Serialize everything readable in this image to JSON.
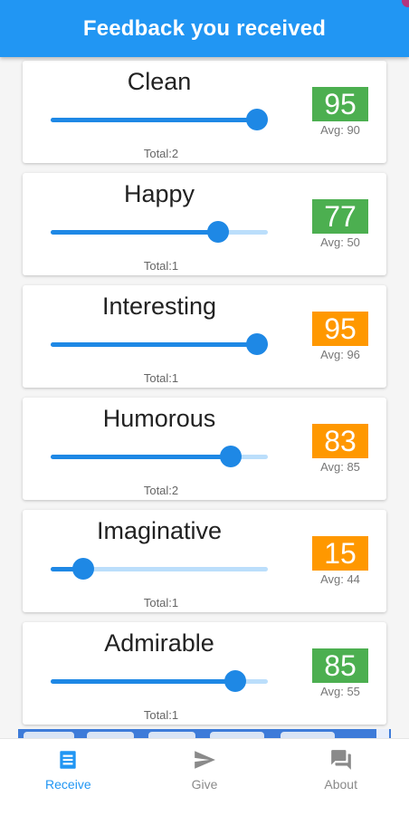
{
  "app": {
    "title": "Feedback you received"
  },
  "cards": [
    {
      "label": "Clean",
      "score": "95",
      "avg": "Avg: 90",
      "total": "Total:2",
      "slider_fraction": 0.95,
      "badge_color": "#4caf50"
    },
    {
      "label": "Happy",
      "score": "77",
      "avg": "Avg: 50",
      "total": "Total:1",
      "slider_fraction": 0.77,
      "badge_color": "#4caf50"
    },
    {
      "label": "Interesting",
      "score": "95",
      "avg": "Avg: 96",
      "total": "Total:1",
      "slider_fraction": 0.95,
      "badge_color": "#ff9800"
    },
    {
      "label": "Humorous",
      "score": "83",
      "avg": "Avg: 85",
      "total": "Total:2",
      "slider_fraction": 0.83,
      "badge_color": "#ff9800"
    },
    {
      "label": "Imaginative",
      "score": "15",
      "avg": "Avg: 44",
      "total": "Total:1",
      "slider_fraction": 0.15,
      "badge_color": "#ff9800"
    },
    {
      "label": "Admirable",
      "score": "85",
      "avg": "Avg: 55",
      "total": "Total:1",
      "slider_fraction": 0.85,
      "badge_color": "#4caf50"
    }
  ],
  "nav": {
    "items": [
      {
        "label": "Receive",
        "icon": "receive-icon",
        "active": true
      },
      {
        "label": "Give",
        "icon": "send-icon",
        "active": false
      },
      {
        "label": "About",
        "icon": "forum-icon",
        "active": false
      }
    ]
  },
  "colors": {
    "primary": "#2196f3",
    "slider_active": "#1e88e5",
    "slider_inactive": "#bbdefb",
    "badge_above_avg": "#4caf50",
    "badge_below_avg": "#ff9800",
    "nav_inactive": "#8a8a8a"
  }
}
